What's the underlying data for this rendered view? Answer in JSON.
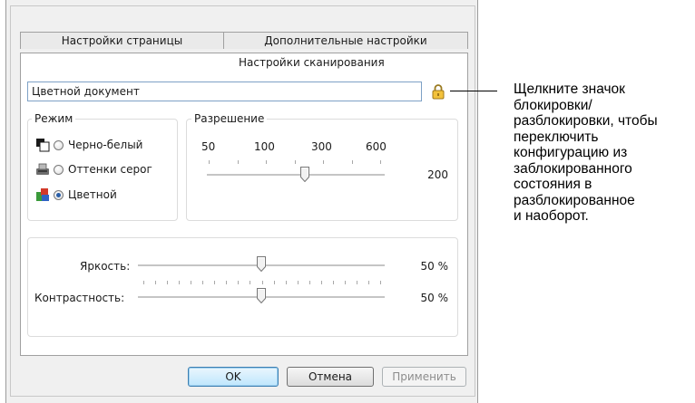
{
  "tabs": {
    "page_settings": "Настройки страницы",
    "advanced_settings": "Дополнительные настройки",
    "scan_settings": "Настройки сканирования"
  },
  "profile": {
    "value": "Цветной документ"
  },
  "mode_group": {
    "label": "Режим",
    "options": [
      {
        "label": "Черно-белый",
        "icon": "bw-document-icon",
        "checked": false
      },
      {
        "label": "Оттенки серог",
        "icon": "grayscale-scanner-icon",
        "checked": false
      },
      {
        "label": "Цветной",
        "icon": "color-blocks-icon",
        "checked": true
      }
    ]
  },
  "resolution_group": {
    "label": "Разрешение",
    "scale_labels": [
      "50",
      "100",
      "300",
      "600"
    ],
    "value": "200",
    "level_fraction": 0.55
  },
  "brightness": {
    "label": "Яркость:",
    "value": "50 %",
    "level_fraction": 0.5
  },
  "contrast": {
    "label": "Контрастность:",
    "value": "50 %",
    "level_fraction": 0.5
  },
  "buttons": {
    "ok": "OK",
    "cancel": "Отмена",
    "apply": "Применить"
  },
  "callout": {
    "text": "Щелкните значок\nблокировки/\nразблокировки, чтобы\nпереключить\nконфигурацию из\nзаблокированного\nсостояния в\nразблокированное\nи наоборот."
  },
  "colors": {
    "accent": "#2a5fa8",
    "lock": "#e0b020"
  }
}
